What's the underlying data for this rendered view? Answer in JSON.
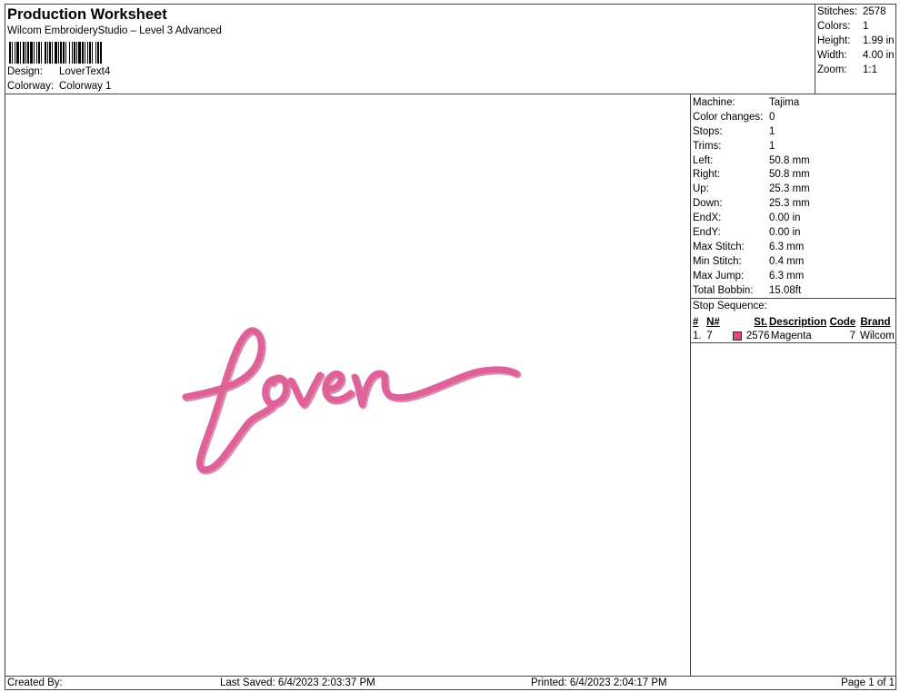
{
  "header": {
    "title": "Production Worksheet",
    "subtitle": "Wilcom EmbroideryStudio – Level 3 Advanced",
    "design_label": "Design:",
    "design_value": "LoverText4",
    "colorway_label": "Colorway:",
    "colorway_value": "Colorway 1"
  },
  "stats": [
    {
      "label": "Stitches:",
      "value": "2578"
    },
    {
      "label": "Colors:",
      "value": "1"
    },
    {
      "label": "Height:",
      "value": "1.99 in"
    },
    {
      "label": "Width:",
      "value": "4.00 in"
    },
    {
      "label": "Zoom:",
      "value": "1:1"
    }
  ],
  "machine_info": [
    {
      "label": "Machine:",
      "value": "Tajima"
    },
    {
      "label": "Color changes:",
      "value": "0"
    },
    {
      "label": "Stops:",
      "value": "1"
    },
    {
      "label": "Trims:",
      "value": "1"
    },
    {
      "label": "Left:",
      "value": "50.8 mm"
    },
    {
      "label": "Right:",
      "value": "50.8 mm"
    },
    {
      "label": "Up:",
      "value": "25.3 mm"
    },
    {
      "label": "Down:",
      "value": "25.3 mm"
    },
    {
      "label": "EndX:",
      "value": "0.00 in"
    },
    {
      "label": "EndY:",
      "value": "0.00 in"
    },
    {
      "label": "Max Stitch:",
      "value": "6.3 mm"
    },
    {
      "label": "Min Stitch:",
      "value": "0.4 mm"
    },
    {
      "label": "Max Jump:",
      "value": "6.3 mm"
    },
    {
      "label": "Total Bobbin:",
      "value": "15.08ft"
    }
  ],
  "stop_sequence": {
    "title": "Stop Sequence:",
    "headers": {
      "num": "#",
      "n": "N#",
      "st": "St.",
      "desc": "Description",
      "code": "Code",
      "brand": "Brand"
    },
    "rows": [
      {
        "num": "1.",
        "n": "7",
        "color": "#e0457b",
        "st": "2576",
        "desc": "Magenta",
        "code": "7",
        "brand": "Wilcom"
      }
    ]
  },
  "design": {
    "text": "lover",
    "thread_color": "#e0609a",
    "thread_shadow": "#b8316a"
  },
  "footer": {
    "created_by": "Created By:",
    "last_saved": "Last Saved: 6/4/2023 2:03:37 PM",
    "printed": "Printed: 6/4/2023 2:04:17 PM",
    "page": "Page 1 of 1"
  }
}
